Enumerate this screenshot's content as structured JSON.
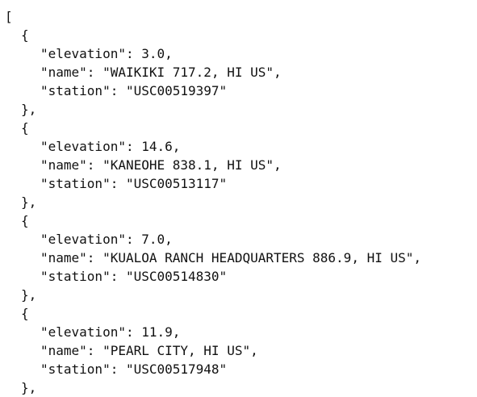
{
  "json_text": {
    "open_bracket": "[",
    "open_brace": "{",
    "close_brace": "},",
    "records": [
      {
        "elevation_line": "\"elevation\": 3.0,",
        "name_line": "\"name\": \"WAIKIKI 717.2, HI US\",",
        "station_line": "\"station\": \"USC00519397\""
      },
      {
        "elevation_line": "\"elevation\": 14.6,",
        "name_line": "\"name\": \"KANEOHE 838.1, HI US\",",
        "station_line": "\"station\": \"USC00513117\""
      },
      {
        "elevation_line": "\"elevation\": 7.0,",
        "name_line": "\"name\": \"KUALOA RANCH HEADQUARTERS 886.9, HI US\",",
        "station_line": "\"station\": \"USC00514830\""
      },
      {
        "elevation_line": "\"elevation\": 11.9,",
        "name_line": "\"name\": \"PEARL CITY, HI US\",",
        "station_line": "\"station\": \"USC00517948\""
      }
    ]
  }
}
